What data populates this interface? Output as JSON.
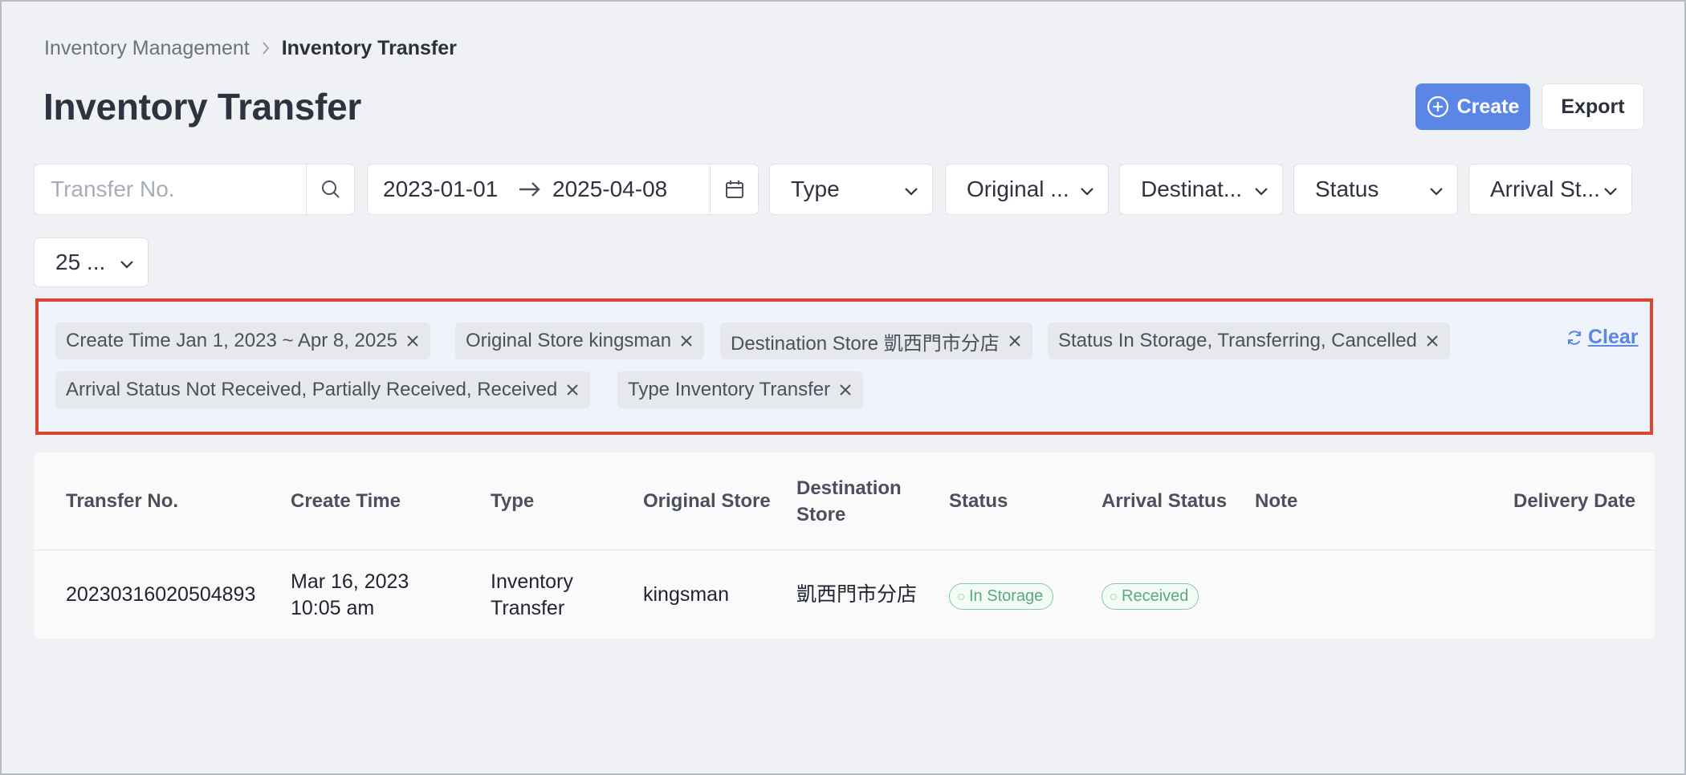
{
  "breadcrumb": {
    "parent": "Inventory Management",
    "current": "Inventory Transfer"
  },
  "page": {
    "title": "Inventory Transfer"
  },
  "actions": {
    "create_label": "Create",
    "export_label": "Export"
  },
  "filters": {
    "search_placeholder": "Transfer No.",
    "date_start": "2023-01-01",
    "date_end": "2025-04-08",
    "type_label": "Type",
    "original_store_label": "Original ...",
    "destination_store_label": "Destinat...",
    "status_label": "Status",
    "arrival_status_label": "Arrival St...",
    "page_size_label": "25 ..."
  },
  "active_tags": [
    {
      "text": "Create Time Jan 1, 2023 ~ Apr 8, 2025"
    },
    {
      "text": "Original Store kingsman"
    },
    {
      "text": "Destination Store 凱西門市分店"
    },
    {
      "text": "Status In Storage, Transferring, Cancelled"
    },
    {
      "text": "Arrival Status Not Received, Partially Received, Received"
    },
    {
      "text": "Type Inventory Transfer"
    }
  ],
  "clear_label": "Clear",
  "table": {
    "columns": {
      "transfer_no": "Transfer No.",
      "create_time": "Create Time",
      "type": "Type",
      "original_store": "Original Store",
      "destination_store_1": "Destination",
      "destination_store_2": "Store",
      "status": "Status",
      "arrival_status": "Arrival Status",
      "note": "Note",
      "delivery_date": "Delivery Date"
    },
    "rows": [
      {
        "transfer_no": "20230316020504893",
        "create_date": "Mar 16, 2023",
        "create_clock": "10:05 am",
        "type_1": "Inventory",
        "type_2": "Transfer",
        "original_store": "kingsman",
        "destination_store": "凱西門市分店",
        "status": "In Storage",
        "arrival_status": "Received",
        "note": "",
        "delivery_date": ""
      }
    ]
  },
  "colors": {
    "accent": "#5b86e5",
    "highlight_border": "#d9452f",
    "success": "#5aa97e"
  }
}
